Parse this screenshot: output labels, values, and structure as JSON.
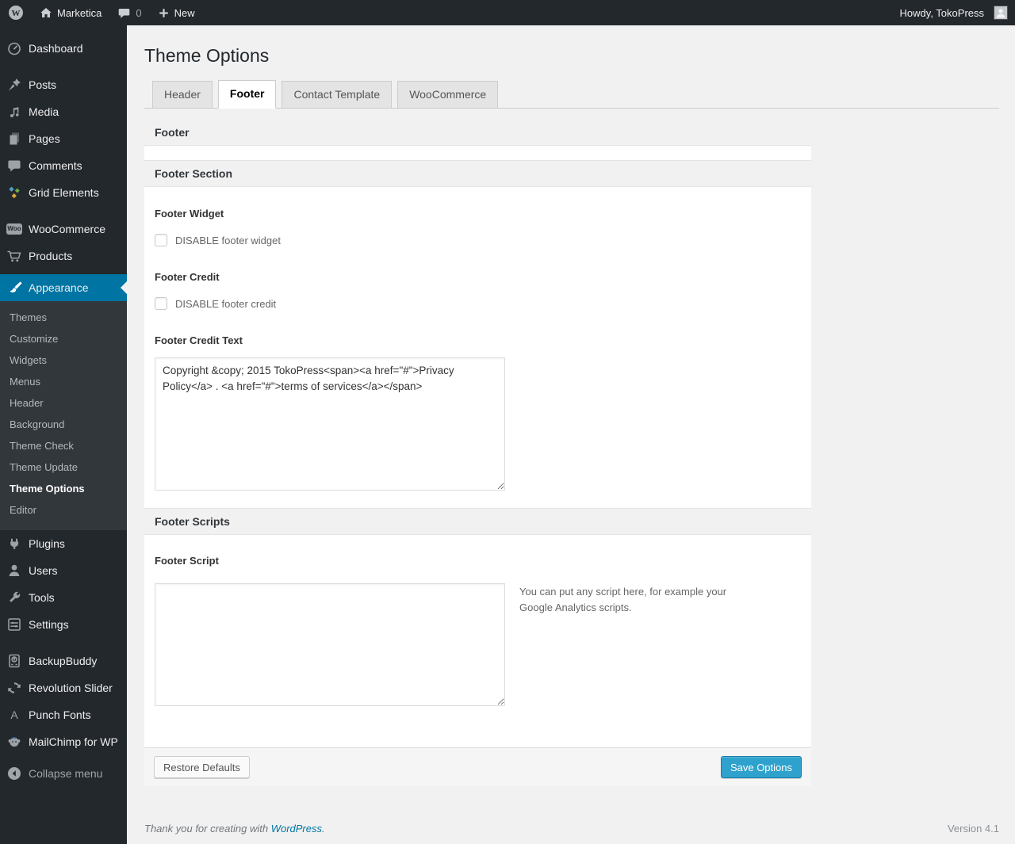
{
  "admin_bar": {
    "site_name": "Marketica",
    "comment_count": "0",
    "new_label": "New",
    "howdy_label": "Howdy, TokoPress"
  },
  "sidebar": {
    "menu": [
      {
        "label": "Dashboard"
      },
      {
        "label": "Posts"
      },
      {
        "label": "Media"
      },
      {
        "label": "Pages"
      },
      {
        "label": "Comments"
      },
      {
        "label": "Grid Elements"
      },
      {
        "label": "WooCommerce"
      },
      {
        "label": "Products"
      },
      {
        "label": "Appearance"
      },
      {
        "label": "Plugins"
      },
      {
        "label": "Users"
      },
      {
        "label": "Tools"
      },
      {
        "label": "Settings"
      },
      {
        "label": "BackupBuddy"
      },
      {
        "label": "Revolution Slider"
      },
      {
        "label": "Punch Fonts"
      },
      {
        "label": "MailChimp for WP"
      },
      {
        "label": "Collapse menu"
      }
    ],
    "appearance_submenu": [
      {
        "label": "Themes"
      },
      {
        "label": "Customize"
      },
      {
        "label": "Widgets"
      },
      {
        "label": "Menus"
      },
      {
        "label": "Header"
      },
      {
        "label": "Background"
      },
      {
        "label": "Theme Check"
      },
      {
        "label": "Theme Update"
      },
      {
        "label": "Theme Options"
      },
      {
        "label": "Editor"
      }
    ]
  },
  "page": {
    "title": "Theme Options",
    "tabs": [
      {
        "label": "Header"
      },
      {
        "label": "Footer"
      },
      {
        "label": "Contact Template"
      },
      {
        "label": "WooCommerce"
      }
    ]
  },
  "panel": {
    "header": "Footer",
    "section1": {
      "title": "Footer Section",
      "widget_label": "Footer Widget",
      "widget_checkbox": "DISABLE footer widget",
      "credit_label": "Footer Credit",
      "credit_checkbox": "DISABLE footer credit",
      "credit_text_label": "Footer Credit Text",
      "credit_text_value": "Copyright &copy; 2015 TokoPress<span><a href=\"#\">Privacy Policy</a> . <a href=\"#\">terms of services</a></span>"
    },
    "section2": {
      "title": "Footer Scripts",
      "script_label": "Footer Script",
      "script_value": "",
      "script_hint": "You can put any script here, for example your Google Analytics scripts."
    },
    "actions": {
      "restore_label": "Restore Defaults",
      "save_label": "Save Options"
    }
  },
  "page_footer": {
    "thanks_prefix": "Thank you for creating with ",
    "wordpress_link": "WordPress",
    "thanks_suffix": ".",
    "version": "Version 4.1"
  },
  "colors": {
    "menu_highlight": "#0074a2",
    "primary_button": "#2ea2cc",
    "link_blue": "#0074a2"
  }
}
